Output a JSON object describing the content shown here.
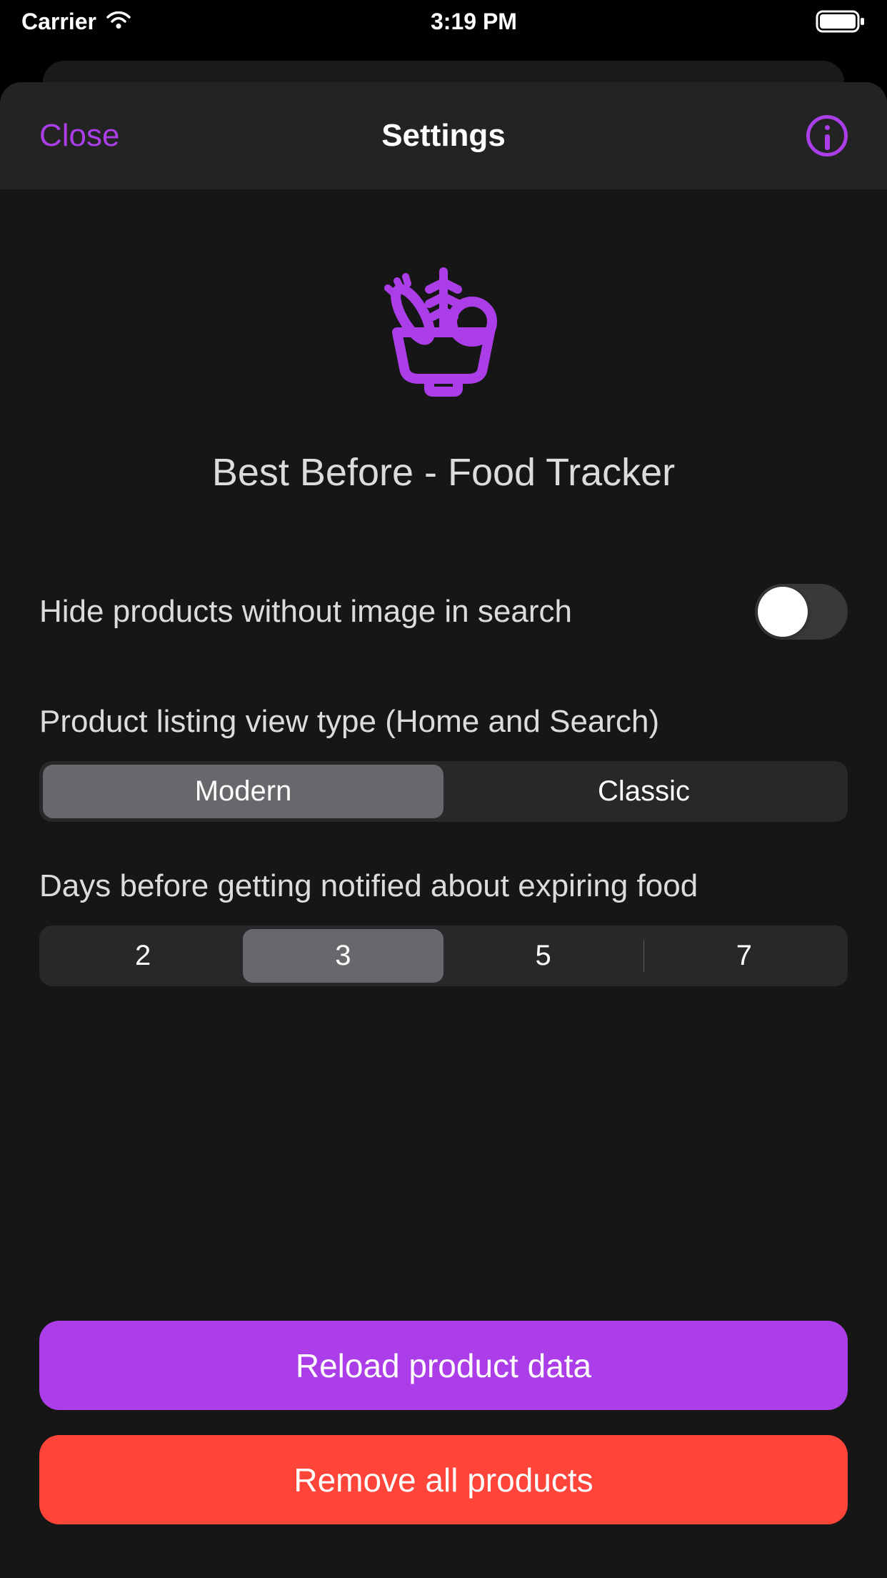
{
  "status_bar": {
    "carrier": "Carrier",
    "time": "3:19 PM"
  },
  "nav": {
    "close_label": "Close",
    "title": "Settings"
  },
  "app": {
    "title": "Best Before - Food Tracker"
  },
  "settings": {
    "hide_products_label": "Hide products without image in search",
    "hide_products_value": false,
    "view_type_label": "Product listing view type (Home and Search)",
    "view_type_options": [
      "Modern",
      "Classic"
    ],
    "view_type_selected": 0,
    "days_label": "Days before getting notified about expiring food",
    "days_options": [
      "2",
      "3",
      "5",
      "7"
    ],
    "days_selected": 1
  },
  "actions": {
    "reload_label": "Reload product data",
    "remove_label": "Remove all products"
  },
  "colors": {
    "accent": "#ab3ee8",
    "danger": "#ff453a"
  }
}
